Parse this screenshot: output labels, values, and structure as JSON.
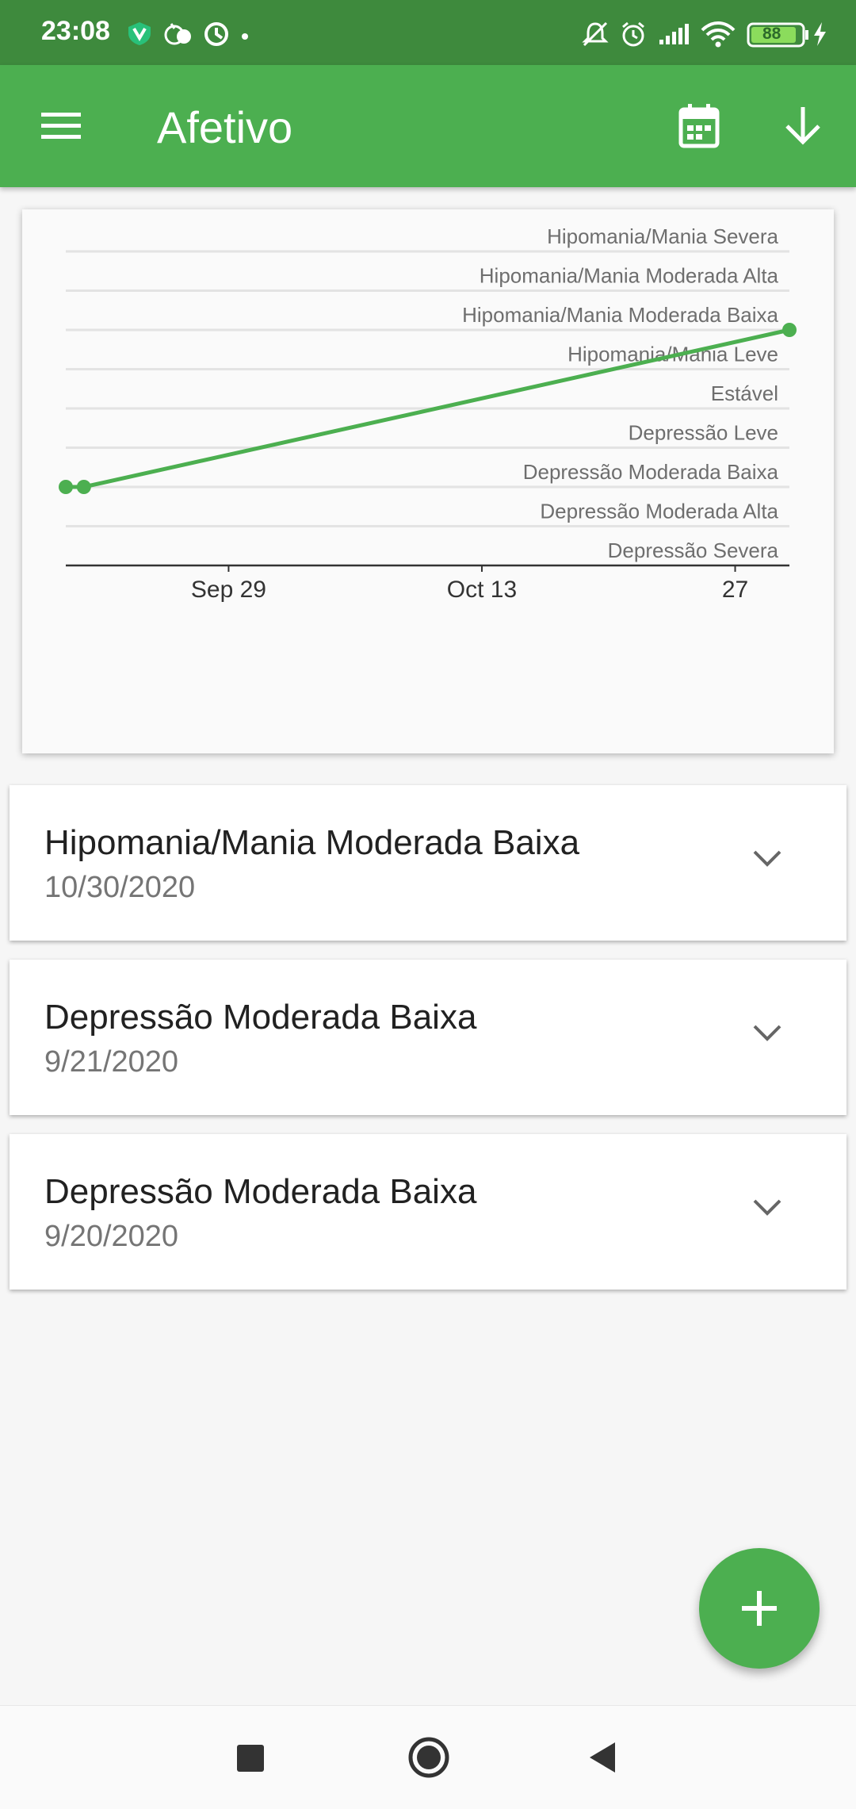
{
  "status_bar": {
    "time": "23:08",
    "battery": "88",
    "icons": [
      "vpn-icon",
      "weather-icon",
      "data-saver-icon",
      "dot-icon",
      "mute-icon",
      "alarm-icon",
      "signal-icon",
      "wifi-icon",
      "battery-icon",
      "charging-icon"
    ]
  },
  "app_bar": {
    "title": "Afetivo",
    "menu_icon": "menu-icon",
    "calendar_icon": "calendar-icon",
    "download_icon": "arrow-down-icon",
    "color": "#4caf50",
    "status_color": "#3e8a3d"
  },
  "chart_data": {
    "type": "line",
    "levels": [
      "Hipomania/Mania Severa",
      "Hipomania/Mania Moderada Alta",
      "Hipomania/Mania Moderada Baixa",
      "Hipomania/Mania Leve",
      "Estável",
      "Depressão Leve",
      "Depressão Moderada Baixa",
      "Depressão Moderada Alta",
      "Depressão Severa"
    ],
    "x_ticks": [
      "Sep 29",
      "Oct 13",
      "27"
    ],
    "x_tick_dates": [
      "2020-09-29",
      "2020-10-13",
      "2020-10-27"
    ],
    "xlim": [
      "2020-09-20",
      "2020-10-30"
    ],
    "points": [
      {
        "date": "2020-09-20",
        "level": "Depressão Moderada Baixa"
      },
      {
        "date": "2020-09-21",
        "level": "Depressão Moderada Baixa"
      },
      {
        "date": "2020-10-30",
        "level": "Hipomania/Mania Moderada Baixa"
      }
    ],
    "line_color": "#4caf50",
    "grid": true
  },
  "entries": [
    {
      "title": "Hipomania/Mania Moderada Baixa",
      "date": "10/30/2020"
    },
    {
      "title": "Depressão Moderada Baixa",
      "date": "9/21/2020"
    },
    {
      "title": "Depressão Moderada Baixa",
      "date": "9/20/2020"
    }
  ],
  "fab": {
    "icon": "plus-icon"
  },
  "nav_bar": {
    "icons": [
      "recents-square-icon",
      "home-circle-icon",
      "back-triangle-icon"
    ]
  }
}
